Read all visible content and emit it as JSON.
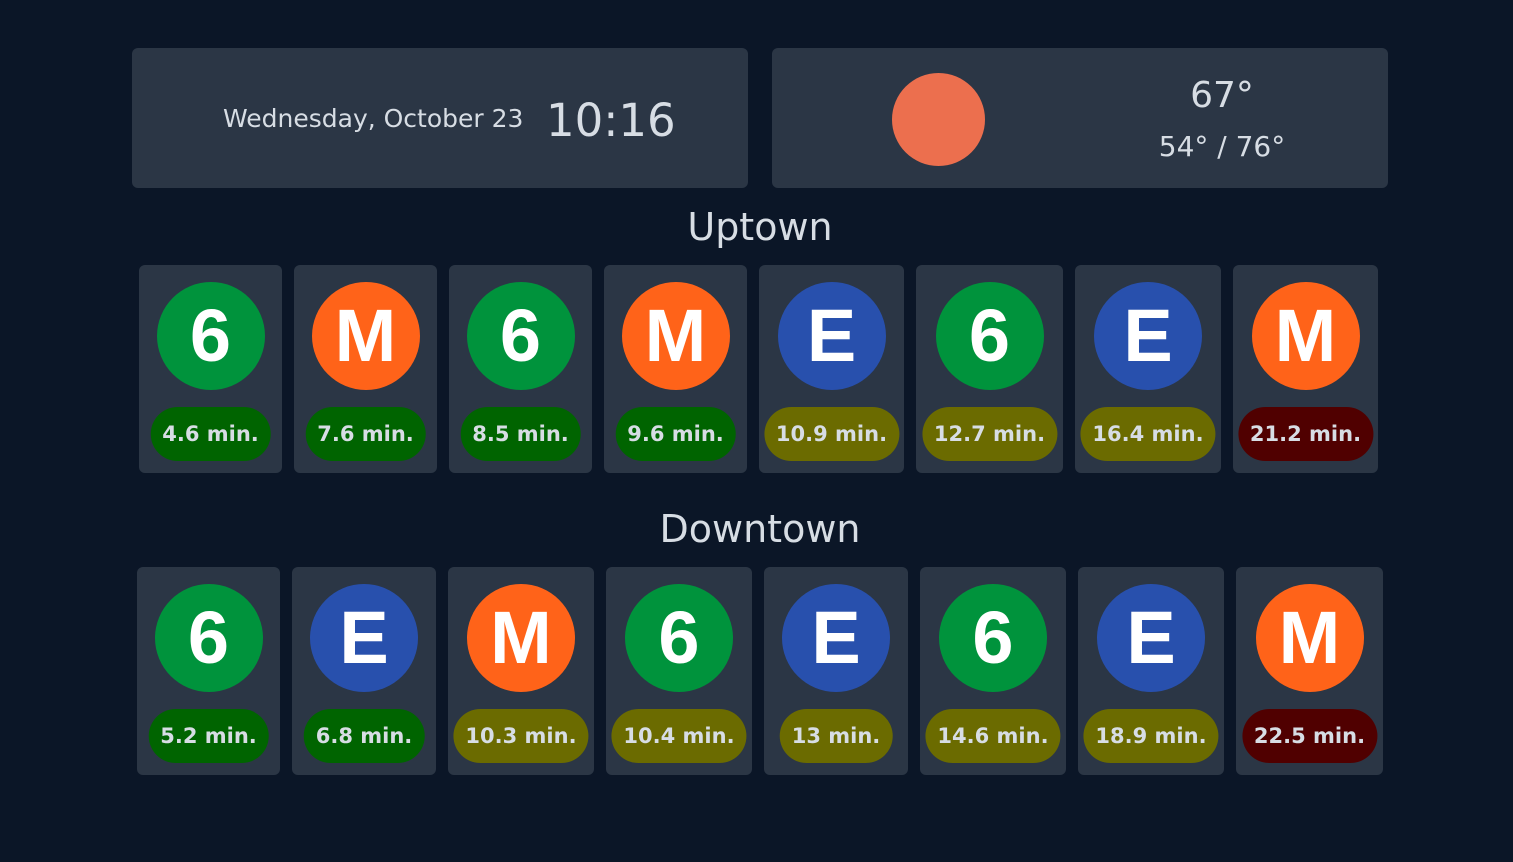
{
  "clock": {
    "date": "Wednesday, October 23",
    "time": "10:16"
  },
  "weather": {
    "icon": "sun-icon",
    "icon_color": "#ec6f4e",
    "current_temp": "67°",
    "range": "54° / 76°"
  },
  "colors": {
    "line_6": "#00933c",
    "line_M": "#ff6319",
    "line_E": "#2850ad",
    "eta_soon": "#006400",
    "eta_medium": "#6b6b00",
    "eta_late": "#500000"
  },
  "uptown": {
    "title": "Uptown",
    "trains": [
      {
        "line": "6",
        "eta": "4.6 min.",
        "status": "soon"
      },
      {
        "line": "M",
        "eta": "7.6 min.",
        "status": "soon"
      },
      {
        "line": "6",
        "eta": "8.5 min.",
        "status": "soon"
      },
      {
        "line": "M",
        "eta": "9.6 min.",
        "status": "soon"
      },
      {
        "line": "E",
        "eta": "10.9 min.",
        "status": "medium"
      },
      {
        "line": "6",
        "eta": "12.7 min.",
        "status": "medium"
      },
      {
        "line": "E",
        "eta": "16.4 min.",
        "status": "medium"
      },
      {
        "line": "M",
        "eta": "21.2 min.",
        "status": "late"
      }
    ]
  },
  "downtown": {
    "title": "Downtown",
    "trains": [
      {
        "line": "6",
        "eta": "5.2 min.",
        "status": "soon"
      },
      {
        "line": "E",
        "eta": "6.8 min.",
        "status": "soon"
      },
      {
        "line": "M",
        "eta": "10.3 min.",
        "status": "medium"
      },
      {
        "line": "6",
        "eta": "10.4 min.",
        "status": "medium"
      },
      {
        "line": "E",
        "eta": "13 min.",
        "status": "medium"
      },
      {
        "line": "6",
        "eta": "14.6 min.",
        "status": "medium"
      },
      {
        "line": "E",
        "eta": "18.9 min.",
        "status": "medium"
      },
      {
        "line": "M",
        "eta": "22.5 min.",
        "status": "late"
      }
    ]
  }
}
